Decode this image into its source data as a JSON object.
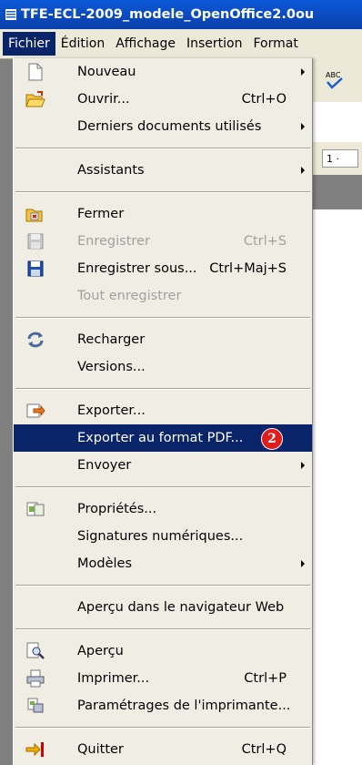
{
  "window": {
    "title": "TFE-ECL-2009_modele_OpenOffice2.0ou"
  },
  "menubar": {
    "items": [
      "Fichier",
      "Édition",
      "Affichage",
      "Insertion",
      "Format"
    ]
  },
  "ruler": {
    "tick_label": "1 ·"
  },
  "menu": {
    "items": [
      {
        "key": "nouveau",
        "label": "Nouveau",
        "submenu": true,
        "icon": "new-document-icon"
      },
      {
        "key": "ouvrir",
        "label": "Ouvrir...",
        "shortcut": "Ctrl+O",
        "icon": "open-folder-icon"
      },
      {
        "key": "recents",
        "label": "Derniers documents utilisés",
        "submenu": true
      },
      {
        "key": "assistants",
        "label": "Assistants",
        "submenu": true
      },
      {
        "key": "fermer",
        "label": "Fermer",
        "icon": "close-document-icon"
      },
      {
        "key": "enregistrer",
        "label": "Enregistrer",
        "shortcut": "Ctrl+S",
        "disabled": true,
        "icon": "save-icon"
      },
      {
        "key": "enregistrer_sous",
        "label": "Enregistrer sous...",
        "shortcut": "Ctrl+Maj+S",
        "icon": "save-as-icon"
      },
      {
        "key": "tout_enregistrer",
        "label": "Tout enregistrer",
        "disabled": true
      },
      {
        "key": "recharger",
        "label": "Recharger",
        "icon": "reload-icon"
      },
      {
        "key": "versions",
        "label": "Versions..."
      },
      {
        "key": "exporter",
        "label": "Exporter...",
        "icon": "export-icon"
      },
      {
        "key": "exporter_pdf",
        "label": "Exporter au format PDF...",
        "highlighted": true,
        "badge": "2"
      },
      {
        "key": "envoyer",
        "label": "Envoyer",
        "submenu": true
      },
      {
        "key": "proprietes",
        "label": "Propriétés...",
        "icon": "properties-icon"
      },
      {
        "key": "signatures",
        "label": "Signatures numériques..."
      },
      {
        "key": "modeles",
        "label": "Modèles",
        "submenu": true
      },
      {
        "key": "apercu_web",
        "label": "Aperçu dans le navigateur Web"
      },
      {
        "key": "apercu",
        "label": "Aperçu",
        "icon": "page-preview-icon"
      },
      {
        "key": "imprimer",
        "label": "Imprimer...",
        "shortcut": "Ctrl+P",
        "icon": "printer-icon"
      },
      {
        "key": "param_imprimante",
        "label": "Paramétrages de l'imprimante...",
        "icon": "printer-settings-icon"
      },
      {
        "key": "quitter",
        "label": "Quitter",
        "shortcut": "Ctrl+Q",
        "icon": "exit-icon"
      }
    ]
  },
  "colors": {
    "highlight": "#0a246a",
    "titlebar": "#0b58d8",
    "badge": "#e21b1b"
  }
}
